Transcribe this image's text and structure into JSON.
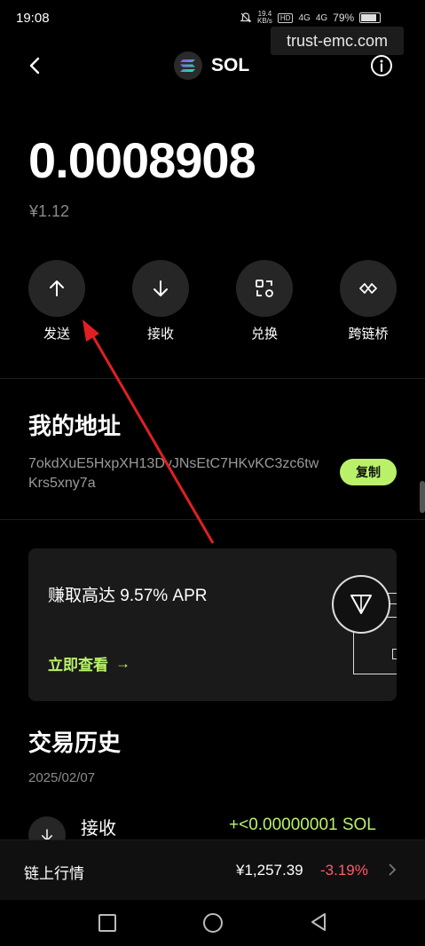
{
  "status_bar": {
    "time": "19:08",
    "speed_value": "19.4",
    "speed_unit": "KB/s",
    "hd_tag": "HD",
    "net1": "4G",
    "net2": "4G",
    "battery": "79%"
  },
  "watermark": "trust-emc.com",
  "header": {
    "title": "SOL",
    "back_icon": "chevron-left-icon",
    "info_icon": "info-icon"
  },
  "balance": {
    "amount": "0.0008908",
    "fiat": "¥1.12"
  },
  "actions": [
    {
      "label": "发送",
      "icon": "arrow-up-icon"
    },
    {
      "label": "接收",
      "icon": "arrow-down-icon"
    },
    {
      "label": "兑换",
      "icon": "swap-icon"
    },
    {
      "label": "跨链桥",
      "icon": "bridge-icon"
    }
  ],
  "address": {
    "title": "我的地址",
    "value": "7okdXuE5HxpXH13DvJNsEtC7HKvKC3zc6twKrs5xny7a",
    "copy_label": "复制"
  },
  "earn_card": {
    "title": "赚取高达 9.57% APR",
    "link": "立即查看",
    "link_arrow": "→"
  },
  "history": {
    "title": "交易历史",
    "date": "2025/02/07",
    "transactions": [
      {
        "type": "接收",
        "amount": "+<0.00000001 SOL"
      }
    ]
  },
  "market": {
    "label": "链上行情",
    "price": "¥1,257.39",
    "change": "-3.19%"
  },
  "colors": {
    "accent": "#b9f26a",
    "negative": "#ff5a6a",
    "annotation_arrow": "#e02020"
  }
}
